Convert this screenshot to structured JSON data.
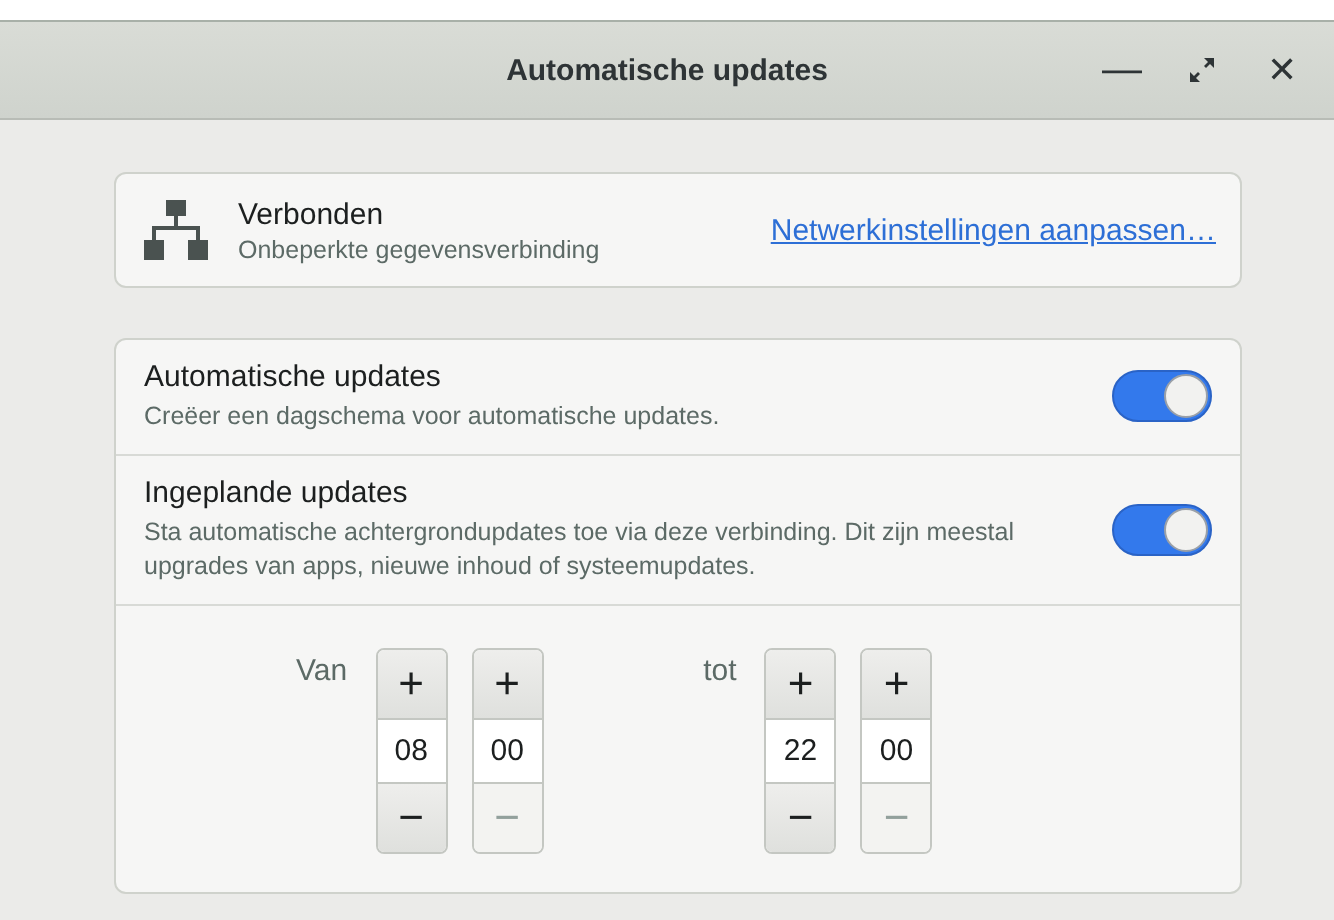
{
  "window": {
    "title": "Automatische updates",
    "controls": [
      {
        "kind": "minimize",
        "label": "—"
      },
      {
        "kind": "maximize"
      },
      {
        "kind": "close",
        "label": "✕"
      }
    ]
  },
  "connection": {
    "title": "Verbonden",
    "subtitle": "Onbeperkte gegevensverbinding",
    "link": "Netwerkinstellingen aanpassen…"
  },
  "settings": [
    {
      "title": "Automatische updates",
      "subtitle": "Creëer een dagschema voor automatische updates.",
      "on": true
    },
    {
      "title": "Ingeplande updates",
      "subtitle": "Sta automatische achtergrondupdates toe via deze verbinding. Dit zijn meestal upgrades van apps, nieuwe inhoud of systeemupdates.",
      "on": true
    }
  ],
  "schedule": [
    {
      "label": "Van",
      "spinners": [
        {
          "plus": "+",
          "value": "08",
          "minus": "−",
          "minus_disabled": false
        },
        {
          "plus": "+",
          "value": "00",
          "minus": "−",
          "minus_disabled": true
        }
      ]
    },
    {
      "label": "tot",
      "spinners": [
        {
          "plus": "+",
          "value": "22",
          "minus": "−",
          "minus_disabled": false
        },
        {
          "plus": "+",
          "value": "00",
          "minus": "−",
          "minus_disabled": true
        }
      ]
    }
  ]
}
